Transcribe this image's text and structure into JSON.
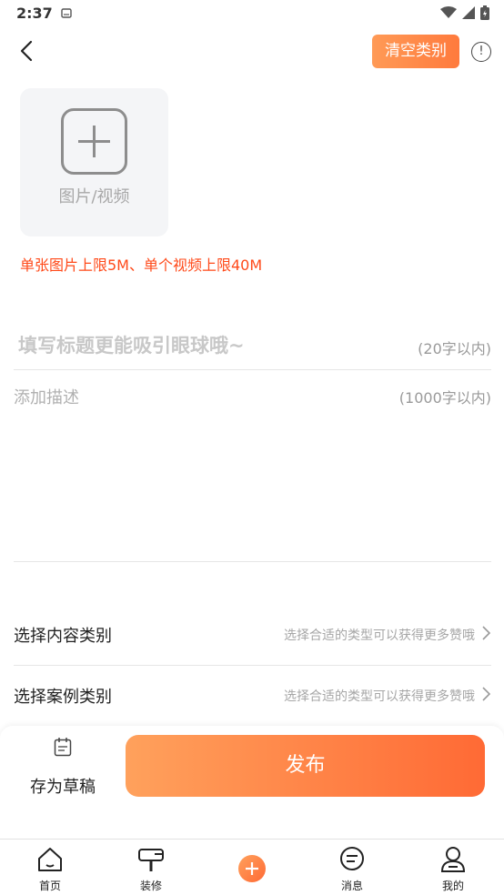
{
  "status": {
    "time": "2:37"
  },
  "header": {
    "clear_category": "清空类别",
    "info_glyph": "!"
  },
  "upload": {
    "label": "图片/视频",
    "limit_note": "单张图片上限5M、单个视频上限40M"
  },
  "title_field": {
    "placeholder": "填写标题更能吸引眼球哦~",
    "counter": "(20字以内)"
  },
  "desc_field": {
    "placeholder": "添加描述",
    "counter": "(1000字以内)"
  },
  "rows": [
    {
      "label": "选择内容类别",
      "hint": "选择合适的类型可以获得更多赞哦"
    },
    {
      "label": "选择案例类别",
      "hint": "选择合适的类型可以获得更多赞哦"
    }
  ],
  "actions": {
    "draft": "存为草稿",
    "publish": "发布"
  },
  "tabs": [
    {
      "label": "首页",
      "icon": "home-icon"
    },
    {
      "label": "装修",
      "icon": "renovation-icon"
    },
    {
      "label": "",
      "icon": "add-icon"
    },
    {
      "label": "消息",
      "icon": "message-icon"
    },
    {
      "label": "我的",
      "icon": "profile-icon"
    }
  ],
  "colors": {
    "accent": "#ff7a3d",
    "warning_text": "#ff4a1a"
  }
}
